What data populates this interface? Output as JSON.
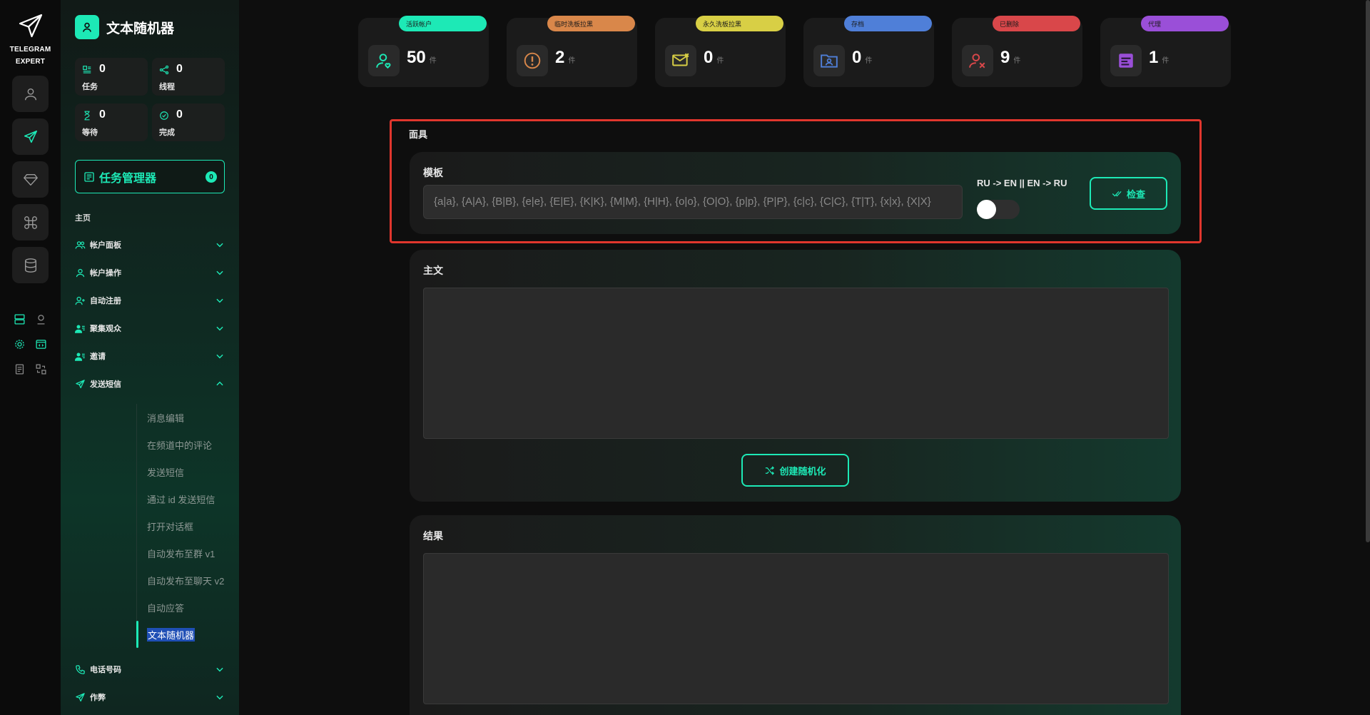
{
  "rail": {
    "brand_line1": "TELEGRAM",
    "brand_line2": "EXPERT"
  },
  "sidebar": {
    "title": "文本随机器",
    "stats": [
      {
        "label": "任务",
        "value": "0"
      },
      {
        "label": "线程",
        "value": "0"
      },
      {
        "label": "等待",
        "value": "0"
      },
      {
        "label": "完成",
        "value": "0"
      }
    ],
    "task_manager": {
      "label": "任务管理器",
      "badge": "0"
    },
    "home_label": "主页",
    "nav": [
      {
        "label": "帐户面板"
      },
      {
        "label": "帐户操作"
      },
      {
        "label": "自动注册"
      },
      {
        "label": "聚集观众"
      },
      {
        "label": "邀请"
      },
      {
        "label": "发送短信"
      },
      {
        "label": "电话号码"
      },
      {
        "label": "作弊"
      }
    ],
    "sub_items": [
      {
        "label": "消息编辑"
      },
      {
        "label": "在频道中的评论"
      },
      {
        "label": "发送短信"
      },
      {
        "label": "通过 id 发送短信"
      },
      {
        "label": "打开对话框"
      },
      {
        "label": "自动发布至群 v1"
      },
      {
        "label": "自动发布至聊天 v2"
      },
      {
        "label": "自动应答"
      },
      {
        "label": "文本随机器"
      }
    ]
  },
  "top_stats": [
    {
      "tag": "活跃帐户",
      "value": "50",
      "unit": "件",
      "color": "#1de9b6",
      "icon": "user-heart-icon"
    },
    {
      "tag": "临时洗板拉黑",
      "value": "2",
      "unit": "件",
      "color": "#d9874a",
      "icon": "warning-circle-icon"
    },
    {
      "tag": "永久洗板拉黑",
      "value": "0",
      "unit": "件",
      "color": "#d8cf45",
      "icon": "mail-blocked-icon"
    },
    {
      "tag": "存档",
      "value": "0",
      "unit": "件",
      "color": "#4f7fd8",
      "icon": "archive-folder-icon"
    },
    {
      "tag": "已删除",
      "value": "9",
      "unit": "件",
      "color": "#d9474a",
      "icon": "user-deleted-icon"
    },
    {
      "tag": "代理",
      "value": "1",
      "unit": "件",
      "color": "#9a4fd8",
      "icon": "proxy-icon"
    }
  ],
  "mask": {
    "section_label": "面具",
    "template_label": "模板",
    "template_value": "{a|a}, {A|A}, {B|B}, {e|e}, {E|E}, {K|K}, {M|M}, {H|H}, {o|o}, {O|O}, {p|p}, {P|P}, {c|c}, {C|C}, {T|T}, {x|x}, {X|X}",
    "lang_label": "RU -> EN || EN -> RU",
    "check_button": "检查"
  },
  "body": {
    "label": "主文",
    "value": "",
    "create_button": "创建随机化"
  },
  "result": {
    "label": "结果",
    "value": ""
  }
}
